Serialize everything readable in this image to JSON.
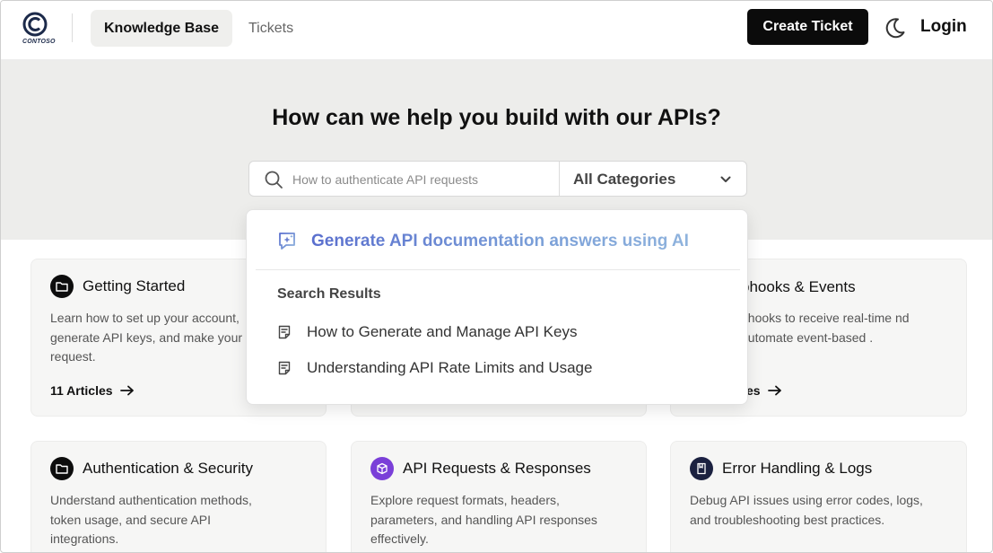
{
  "brand": {
    "logo_text": "CONTOSO"
  },
  "nav": {
    "knowledge_base": "Knowledge Base",
    "tickets": "Tickets",
    "create_ticket": "Create Ticket",
    "login": "Login"
  },
  "hero": {
    "title": "How can we help you build with our APIs?"
  },
  "search": {
    "placeholder": "How to authenticate API requests",
    "category": "All Categories"
  },
  "dropdown": {
    "ai_suggestion": "Generate API documentation answers using AI",
    "results_heading": "Search Results",
    "results": [
      "How to Generate and Manage API Keys",
      "Understanding API Rate Limits and Usage"
    ]
  },
  "cards": [
    {
      "title": "Getting Started",
      "desc": "Learn how to set up your account, generate API keys, and make your request.",
      "link": "11 Articles",
      "icon": "folder-icon"
    },
    {
      "title": "phooks & Events",
      "desc": "bhooks to receive real-time nd automate event-based .",
      "link": "es",
      "icon": "folder-icon"
    },
    {
      "title": "Authentication & Security",
      "desc": "Understand authentication methods, token usage, and secure API integrations.",
      "icon": "folder-icon"
    },
    {
      "title": "API Requests & Responses",
      "desc": "Explore request formats, headers, parameters, and handling API responses effectively.",
      "icon": "cube-icon"
    },
    {
      "title": "Error Handling & Logs",
      "desc": "Debug API issues using error codes, logs, and troubleshooting best practices.",
      "icon": "book-icon"
    }
  ],
  "colors": {
    "accent_dark": "#0b0b0b",
    "hero_bg": "#ededeb",
    "card_bg": "#f6f6f5",
    "ai_gradient_start": "#5a6fce",
    "ai_gradient_end": "#8fb3dd",
    "purple_icon": "#7a3fd8",
    "navy_icon": "#1b2140"
  }
}
